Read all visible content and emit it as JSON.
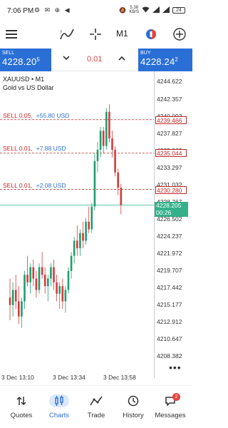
{
  "status_bar": {
    "time": "7:06 PM",
    "speed_value": "5.38",
    "speed_unit": "KB/S",
    "battery": "24"
  },
  "toolbar": {
    "timeframe": "M1"
  },
  "trade_bar": {
    "sell_label": "SELL",
    "sell_price_main": "4228.20",
    "sell_price_sup": "5",
    "buy_label": "BUY",
    "buy_price_main": "4228.24",
    "buy_price_sup": "2",
    "volume": "0.01"
  },
  "chart": {
    "symbol": "XAUUSD • M1",
    "description": "Gold vs US Dollar",
    "y_ticks": [
      "4244.622",
      "4242.357",
      "4240.093",
      "4237.827",
      "4235.562",
      "4233.297",
      "4231.032",
      "4228.767",
      "4226.502",
      "4224.237",
      "4221.972",
      "4219.707",
      "4217.442",
      "4215.177",
      "4212.912",
      "4210.647",
      "4208.382"
    ],
    "x_ticks": [
      "3 Dec 13:10",
      "3 Dec 13:34",
      "3 Dec 13:58"
    ],
    "orders": [
      {
        "label": "SELL 0.05,",
        "profit": "+55.80 USD",
        "price": "4239.466"
      },
      {
        "label": "SELL 0.01,",
        "profit": "+7.88 USD",
        "price": "4235.044"
      },
      {
        "label": "SELL 0.01,",
        "profit": "+2.08 USD",
        "price": "4230.280"
      }
    ],
    "current_price": "4228.205",
    "countdown": "00:26"
  },
  "chart_data": {
    "type": "candlestick",
    "symbol": "XAUUSD",
    "timeframe": "M1",
    "ylim": [
      4207.0,
      4245.5
    ],
    "x_ticks": [
      "3 Dec 13:10",
      "3 Dec 13:34",
      "3 Dec 13:58"
    ],
    "ohlc": [
      [
        4216.0,
        4218.5,
        4213.0,
        4215.0
      ],
      [
        4215.0,
        4218.0,
        4213.5,
        4217.0
      ],
      [
        4217.0,
        4219.0,
        4214.5,
        4215.5
      ],
      [
        4215.5,
        4217.5,
        4212.5,
        4213.5
      ],
      [
        4213.5,
        4216.0,
        4212.0,
        4215.5
      ],
      [
        4215.5,
        4219.5,
        4214.5,
        4219.0
      ],
      [
        4219.0,
        4221.5,
        4217.5,
        4218.0
      ],
      [
        4218.0,
        4220.5,
        4216.5,
        4220.0
      ],
      [
        4220.0,
        4221.0,
        4217.5,
        4218.5
      ],
      [
        4218.5,
        4219.5,
        4216.0,
        4217.0
      ],
      [
        4217.0,
        4220.5,
        4216.5,
        4220.0
      ],
      [
        4220.0,
        4222.0,
        4218.5,
        4219.0
      ],
      [
        4219.0,
        4220.0,
        4216.5,
        4217.5
      ],
      [
        4217.5,
        4219.0,
        4215.5,
        4218.5
      ],
      [
        4218.5,
        4220.5,
        4217.5,
        4220.0
      ],
      [
        4220.0,
        4221.0,
        4217.0,
        4218.0
      ],
      [
        4218.0,
        4219.0,
        4215.5,
        4216.5
      ],
      [
        4216.5,
        4218.0,
        4214.5,
        4217.5
      ],
      [
        4217.5,
        4218.5,
        4214.5,
        4215.5
      ],
      [
        4215.5,
        4217.5,
        4214.0,
        4217.0
      ],
      [
        4217.0,
        4220.0,
        4216.5,
        4219.5
      ],
      [
        4219.5,
        4222.0,
        4218.5,
        4221.5
      ],
      [
        4221.5,
        4224.0,
        4220.5,
        4223.5
      ],
      [
        4223.5,
        4225.5,
        4221.5,
        4222.5
      ],
      [
        4222.5,
        4225.0,
        4221.5,
        4224.5
      ],
      [
        4224.5,
        4226.0,
        4222.5,
        4223.5
      ],
      [
        4223.5,
        4226.5,
        4223.0,
        4226.0
      ],
      [
        4226.0,
        4228.0,
        4224.5,
        4225.0
      ],
      [
        4225.0,
        4228.5,
        4224.5,
        4228.0
      ],
      [
        4228.0,
        4235.0,
        4227.5,
        4234.0
      ],
      [
        4234.0,
        4236.5,
        4232.5,
        4235.5
      ],
      [
        4235.5,
        4238.5,
        4234.5,
        4238.0
      ],
      [
        4238.0,
        4238.5,
        4235.0,
        4236.0
      ],
      [
        4236.0,
        4241.0,
        4235.5,
        4240.5
      ],
      [
        4240.5,
        4241.5,
        4236.5,
        4237.0
      ],
      [
        4237.0,
        4238.0,
        4234.5,
        4235.5
      ],
      [
        4235.5,
        4236.0,
        4232.0,
        4232.5
      ],
      [
        4232.5,
        4233.0,
        4229.5,
        4230.5
      ],
      [
        4230.5,
        4231.0,
        4227.0,
        4228.2
      ]
    ]
  }
}
